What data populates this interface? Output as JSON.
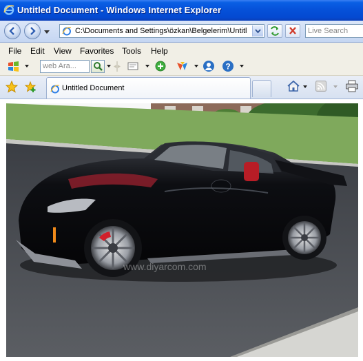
{
  "window": {
    "title": "Untitled Document - Windows Internet Explorer"
  },
  "address": {
    "url": "C:\\Documents and Settings\\özkan\\Belgelerim\\Untitled",
    "search_placeholder": "Live Search"
  },
  "menu": {
    "items": [
      "File",
      "Edit",
      "View",
      "Favorites",
      "Tools",
      "Help"
    ]
  },
  "toolbar": {
    "web_search_placeholder": "web Ara..."
  },
  "tabs": [
    {
      "label": "Untitled Document",
      "active": true
    }
  ],
  "content": {
    "image_watermark": "www.diyarcom.com",
    "image_subject": "black sports car on asphalt"
  },
  "icons": {
    "back": "back-arrow-icon",
    "forward": "forward-arrow-icon",
    "page": "ie-page-icon",
    "refresh": "refresh-icon",
    "stop": "stop-icon",
    "favorites": "star-icon",
    "add_favorite": "add-favorite-icon",
    "home": "home-icon",
    "feeds": "rss-feed-icon",
    "print": "printer-icon"
  },
  "colors": {
    "titlebar": "#0550d8",
    "accent": "#3a80f3"
  }
}
